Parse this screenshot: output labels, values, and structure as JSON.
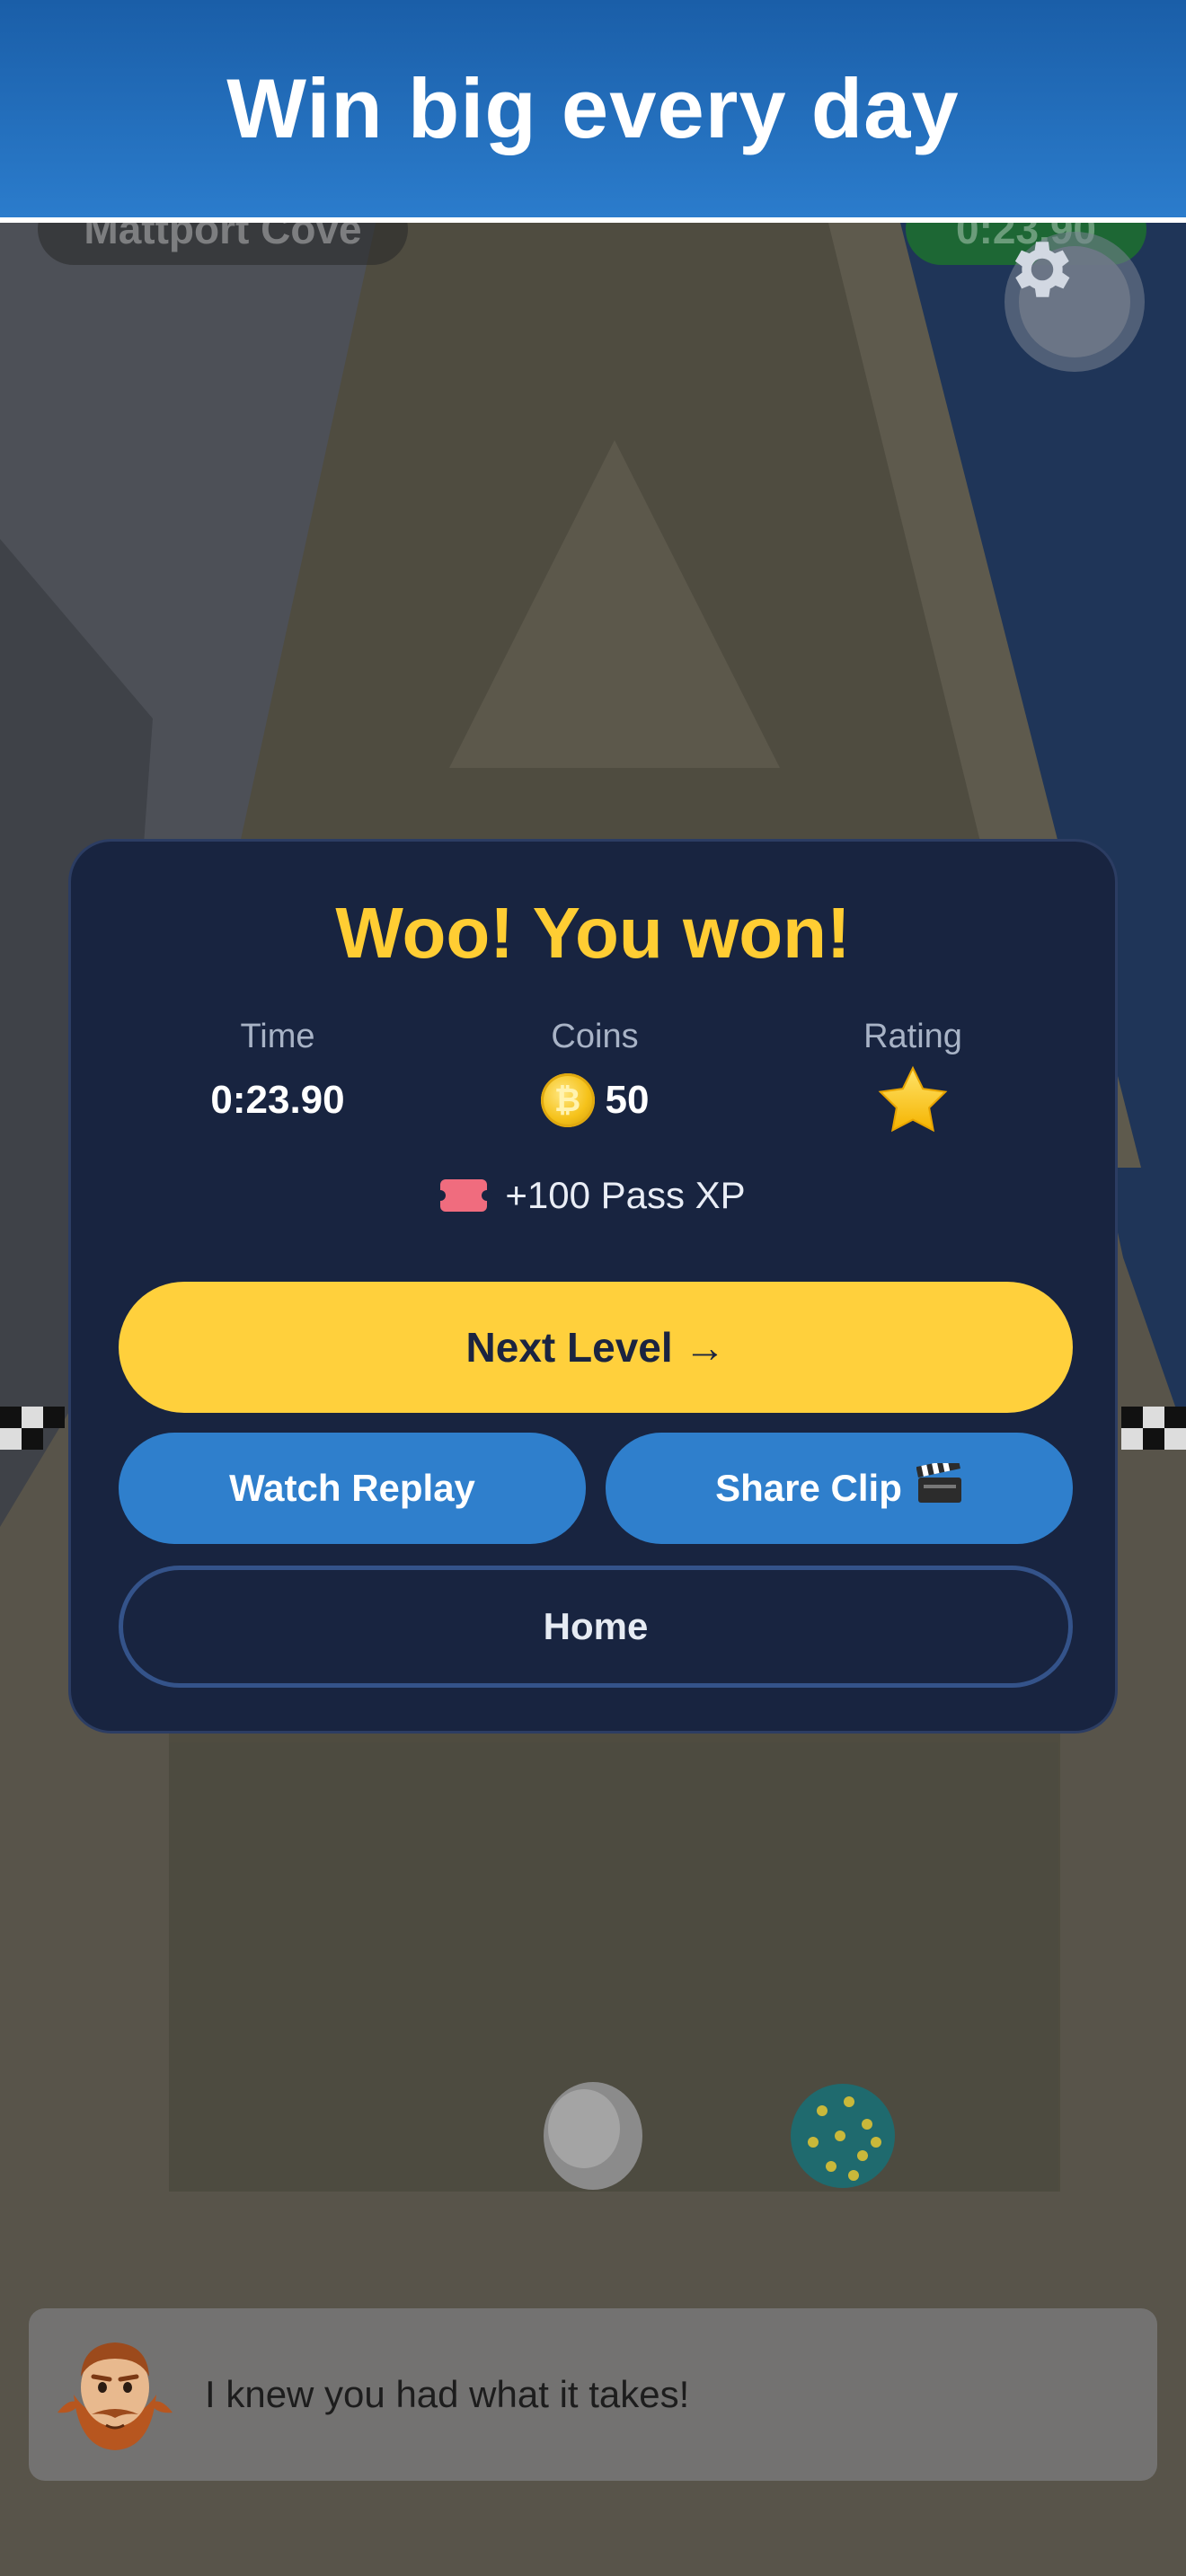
{
  "banner": {
    "title": "Win big every day"
  },
  "hud": {
    "level_name": "Mattport Cove",
    "timer": "0:23.90"
  },
  "result": {
    "title": "Woo! You won!",
    "stats": {
      "time_label": "Time",
      "time_value": "0:23.90",
      "coins_label": "Coins",
      "coins_value": "50",
      "rating_label": "Rating",
      "rating_stars": 1
    },
    "pass_xp": "+100 Pass XP",
    "buttons": {
      "next": "Next Level →",
      "replay": "Watch Replay",
      "share": "Share Clip",
      "home": "Home"
    }
  },
  "dialog": {
    "text": "I knew you had what it takes!"
  },
  "colors": {
    "banner": "#1a5ea8",
    "modal_bg": "#182440",
    "title_yellow": "#ffcd33",
    "primary_button": "#ffd03c",
    "secondary_button": "#2f7fcc"
  },
  "icons": [
    "gear-icon",
    "coin-icon",
    "star-icon",
    "ticket-icon",
    "clapperboard-icon",
    "character-avatar"
  ]
}
